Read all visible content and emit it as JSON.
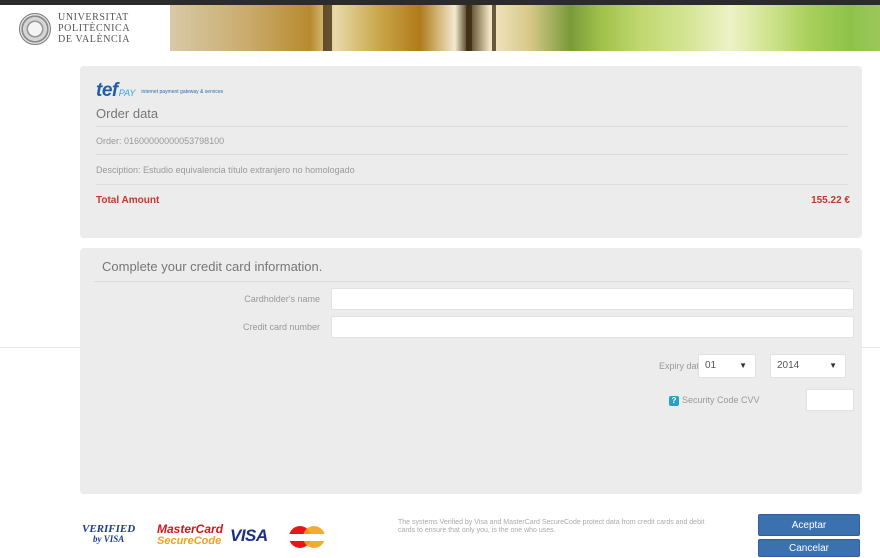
{
  "header": {
    "university_lines": [
      "UNIVERSITAT",
      "POLITÈCNICA",
      "DE VALÈNCIA"
    ]
  },
  "brand": {
    "tef": "tef",
    "pay": "PAY",
    "tagline": "internet payment gateway & services"
  },
  "order": {
    "title": "Order data",
    "order_label": "Order:",
    "order_number": "01600000000053798100",
    "description_label": "Desciption:",
    "description": "Estudio equivalencia título extranjero no homologado",
    "total_label": "Total Amount",
    "total_value": "155.22 €"
  },
  "card": {
    "title": "Complete your credit card information.",
    "cardholder_label": "Cardholder's name",
    "cardholder_value": "",
    "number_label": "Credit card number",
    "number_value": "",
    "expiry_label": "Expiry date",
    "expiry_month": "01",
    "expiry_year": "2014",
    "cvv_help": "?",
    "cvv_label": "Security Code CVV",
    "cvv_value": ""
  },
  "footer": {
    "verified_line1": "VERIFIED",
    "verified_line2": "by VISA",
    "mastercard_line1": "MasterCard",
    "mastercard_line2": "SecureCode",
    "visa": "VISA",
    "note": "The systems Verified by Visa and MasterCard SecureCode protect data from credit cards and debit cards to ensure that only you, is the one who uses."
  },
  "buttons": {
    "accept": "Aceptar",
    "cancel": "Cancelar"
  },
  "colors": {
    "accent_blue": "#3c71b0",
    "total_red": "#c0392b",
    "panel_bg": "#ececec"
  }
}
